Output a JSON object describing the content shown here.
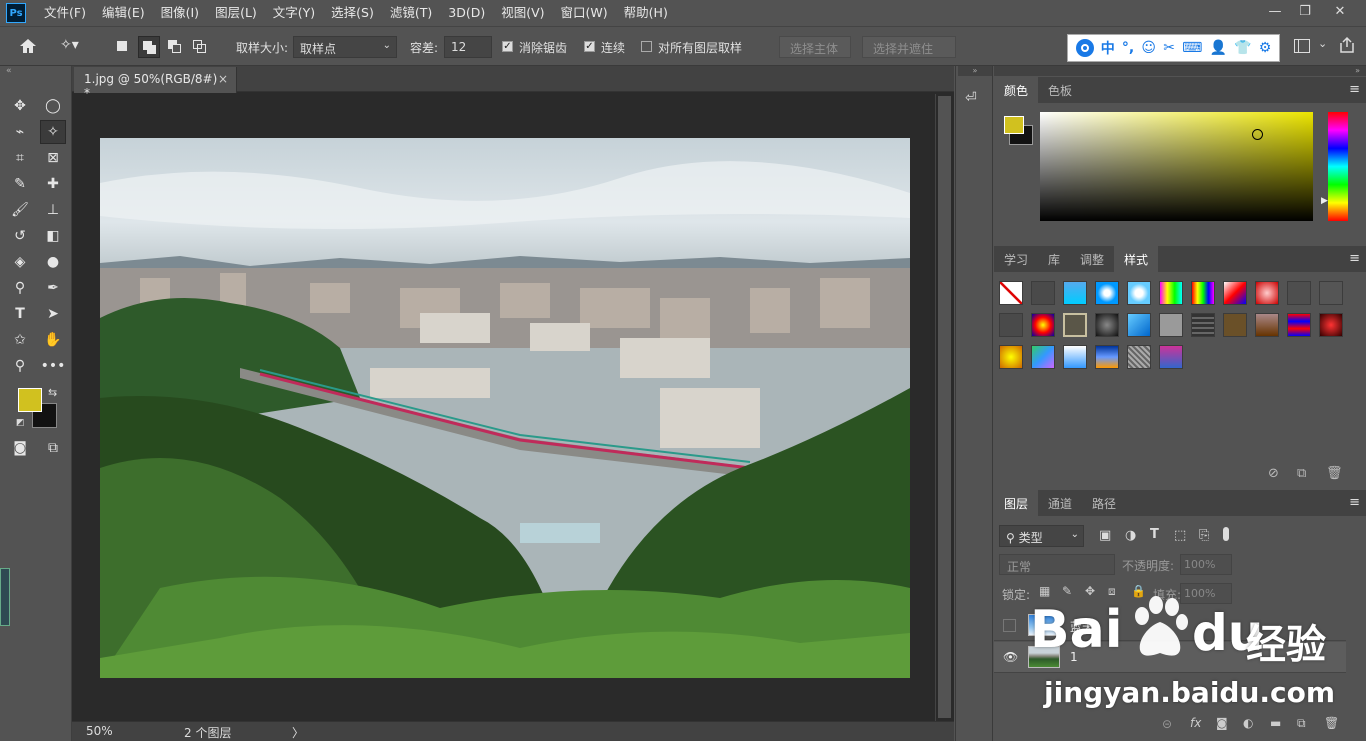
{
  "app": {
    "logo": "Ps"
  },
  "menu": [
    "文件(F)",
    "编辑(E)",
    "图像(I)",
    "图层(L)",
    "文字(Y)",
    "选择(S)",
    "滤镜(T)",
    "3D(D)",
    "视图(V)",
    "窗口(W)",
    "帮助(H)"
  ],
  "options": {
    "sample_size_label": "取样大小:",
    "sample_size_value": "取样点",
    "tolerance_label": "容差:",
    "tolerance_value": "12",
    "antialias_label": "消除锯齿",
    "contiguous_label": "连续",
    "all_layers_label": "对所有图层取样",
    "select_subject": "选择主体",
    "select_mask": "选择并遮住 ..."
  },
  "sogou": {
    "items": [
      "中",
      "°,",
      "☺",
      "✂",
      "⌨",
      "👤",
      "👕",
      "⚙"
    ]
  },
  "document": {
    "tab_title": "1.jpg @ 50%(RGB/8#) *",
    "close": "×"
  },
  "status": {
    "zoom": "50%",
    "info": "2 个图层",
    "arrow": "〉"
  },
  "colors": {
    "foreground": "#d1c11f",
    "background": "#121212"
  },
  "color_panel": {
    "tabs": [
      "颜色",
      "色板"
    ]
  },
  "styles_panel": {
    "tabs": [
      "学习",
      "库",
      "调整",
      "样式"
    ]
  },
  "layers_panel": {
    "tabs": [
      "图层",
      "通道",
      "路径"
    ],
    "filter_label": "类型",
    "blend_mode": "正常",
    "opacity_label": "不透明度:",
    "opacity_value": "100%",
    "lock_label": "锁定:",
    "fill_label": "填充:",
    "fill_value": "100%",
    "layers": [
      {
        "name": "蓝天",
        "visible": false
      },
      {
        "name": "1",
        "visible": true
      }
    ]
  },
  "watermark": {
    "brand_latin": "Bai",
    "brand_du": "du",
    "brand_cn": "经验",
    "url": "jingyan.baidu.com"
  }
}
